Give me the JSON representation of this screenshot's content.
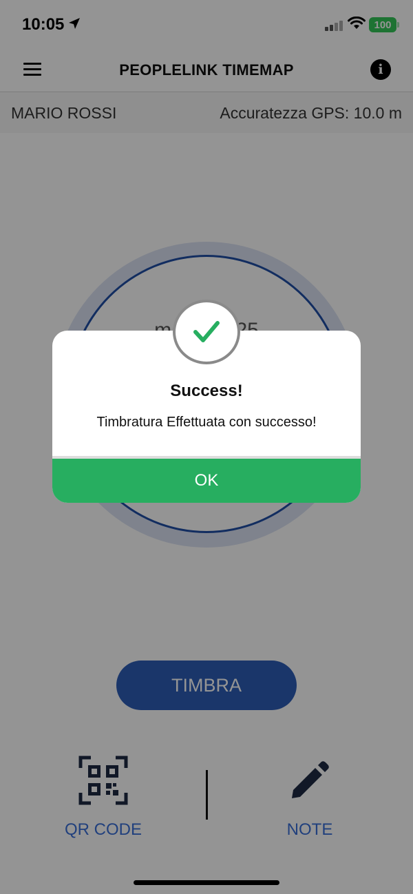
{
  "status_bar": {
    "time": "10:05",
    "battery": "100"
  },
  "header": {
    "title": "PEOPLELINK TIMEMAP"
  },
  "user_bar": {
    "name": "MARIO ROSSI",
    "gps_accuracy": "Accuratezza GPS: 10.0 m"
  },
  "clock": {
    "date_text": "mar 0 2025"
  },
  "actions": {
    "timbra_label": "TIMBRA",
    "qr_label": "QR CODE",
    "note_label": "NOTE"
  },
  "dialog": {
    "title": "Success!",
    "message": "Timbratura Effettuata con successo!",
    "ok_label": "OK"
  },
  "colors": {
    "primary_blue": "#2d5db7",
    "success_green": "#27ae60",
    "overlay": "rgba(0,0,0,0.42)"
  }
}
